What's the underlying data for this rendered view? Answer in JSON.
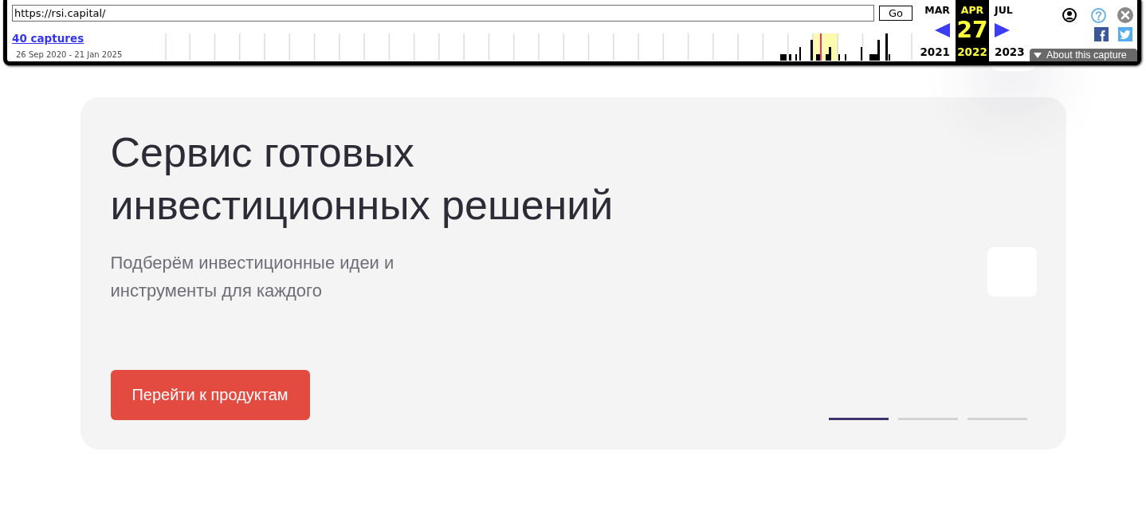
{
  "wayback_toolbar": {
    "url_field": {
      "value": "https://rsi.capital/"
    },
    "go_button": "Go",
    "captures_link": "40 captures",
    "date_range": "26 Sep 2020 - 21 Jan 2025",
    "calendar": [
      {
        "month": "MAR",
        "year": "2021",
        "selected": false
      },
      {
        "month": "APR",
        "day": "27",
        "year": "2022",
        "selected": true
      },
      {
        "month": "JUL",
        "year": "2023",
        "selected": false
      }
    ],
    "about_button": "About this capture"
  },
  "hero": {
    "title": "Сервис готовых инвестиционных решений",
    "subtitle": "Подберём инвестиционные идеи и инструменты для каждого",
    "cta_button": "Перейти к продуктам",
    "slide_indicators": [
      {
        "selected": true
      },
      {
        "selected": false
      },
      {
        "selected": false
      }
    ]
  }
}
